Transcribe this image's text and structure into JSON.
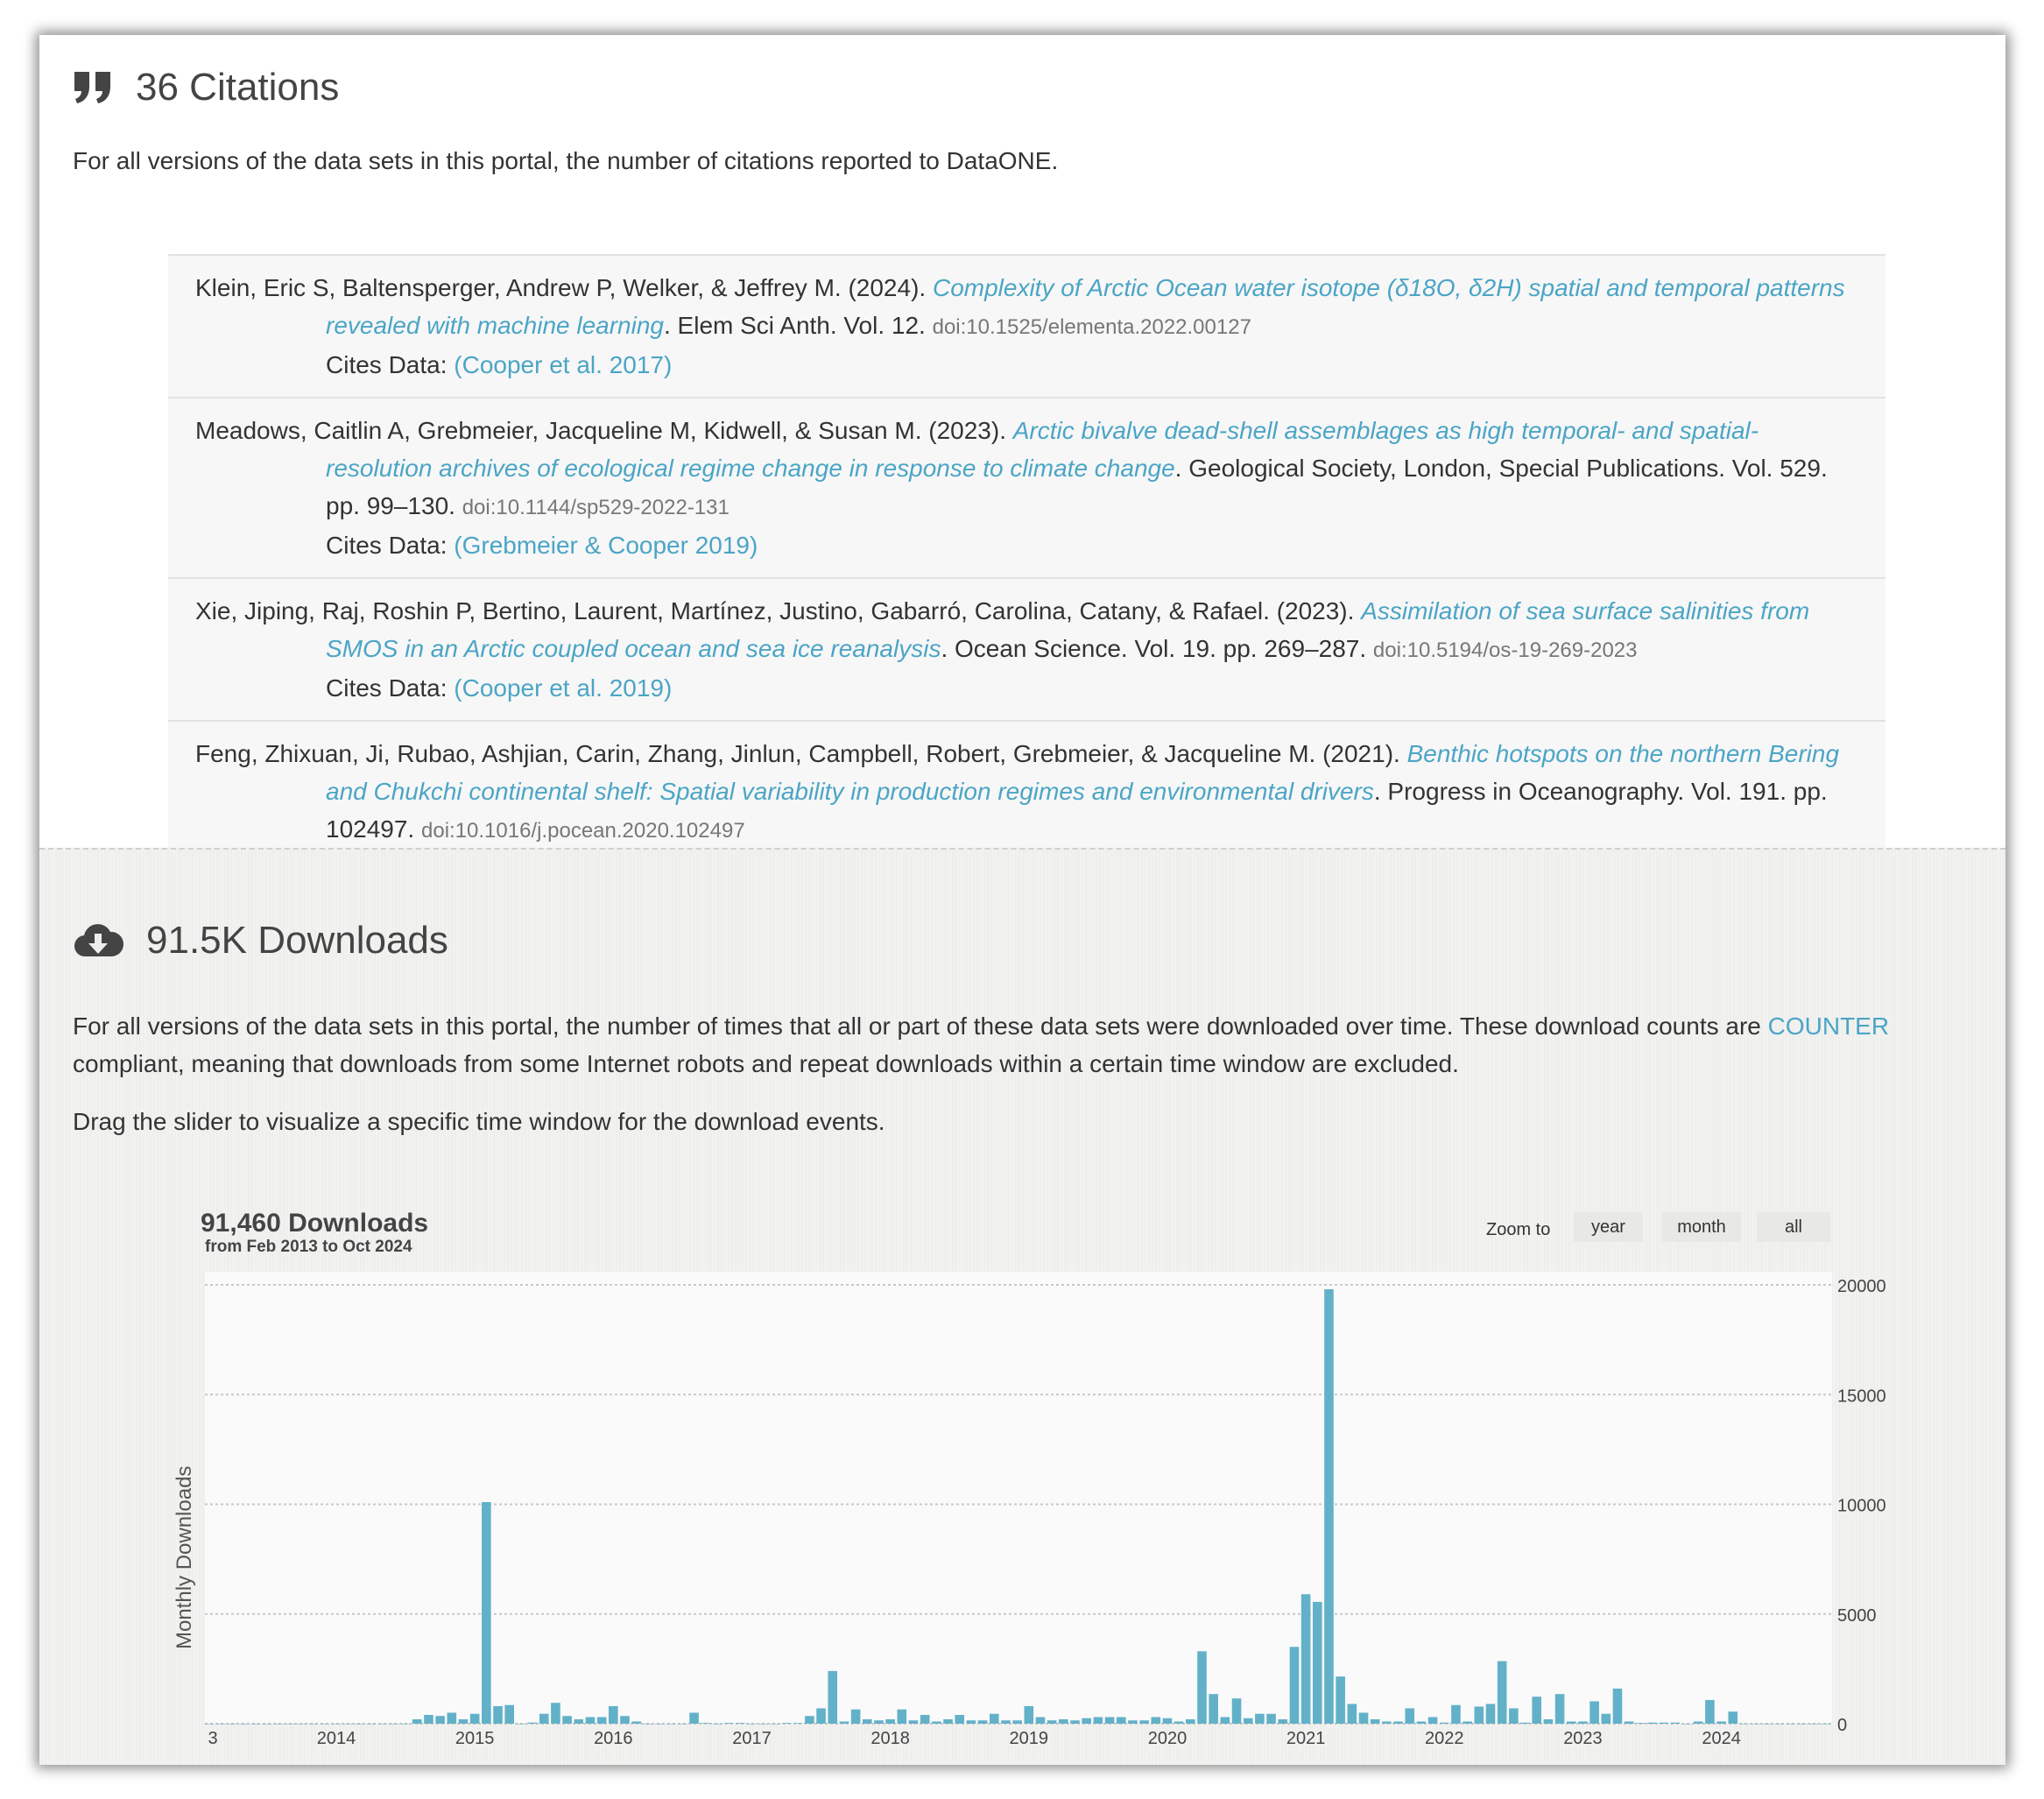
{
  "citations": {
    "heading": "36 Citations",
    "icon": "quote-icon",
    "description": "For all versions of the data sets in this portal, the number of citations reported to DataONE.",
    "items": [
      {
        "authors": "Klein, Eric S, Baltensperger, Andrew P, Welker, & Jeffrey M. (2024). ",
        "title": "Complexity of Arctic Ocean water isotope (δ18O, δ2H) spatial and temporal patterns revealed with machine learning",
        "rest": ". Elem Sci Anth. Vol. 12. ",
        "doi": "doi:10.1525/elementa.2022.00127",
        "cites_label": "Cites Data: ",
        "cites_link": "(Cooper et al. 2017)"
      },
      {
        "authors": "Meadows, Caitlin A, Grebmeier, Jacqueline M, Kidwell, & Susan M. (2023). ",
        "title": "Arctic bivalve dead-shell assemblages as high temporal- and spatial-resolution archives of ecological regime change in response to climate change",
        "rest": ". Geological Society, London, Special Publications. Vol. 529. pp. 99–130. ",
        "doi": "doi:10.1144/sp529-2022-131",
        "cites_label": "Cites Data: ",
        "cites_link": "(Grebmeier & Cooper 2019)"
      },
      {
        "authors": "Xie, Jiping, Raj, Roshin P, Bertino, Laurent, Martínez, Justino, Gabarró, Carolina, Catany, & Rafael. (2023). ",
        "title": "Assimilation of sea surface salinities from SMOS in an Arctic coupled ocean and sea ice reanalysis",
        "rest": ". Ocean Science. Vol. 19. pp. 269–287. ",
        "doi": "doi:10.5194/os-19-269-2023",
        "cites_label": "Cites Data: ",
        "cites_link": "(Cooper et al. 2019)"
      },
      {
        "authors": "Feng, Zhixuan, Ji, Rubao, Ashjian, Carin, Zhang, Jinlun, Campbell, Robert, Grebmeier, & Jacqueline M. (2021). ",
        "title": "Benthic hotspots on the northern Bering and Chukchi continental shelf: Spatial variability in production regimes and environmental drivers",
        "rest": ". Progress in Oceanography. Vol. 191. pp. 102497. ",
        "doi": "doi:10.1016/j.pocean.2020.102497"
      }
    ]
  },
  "downloads": {
    "heading": "91.5K Downloads",
    "icon": "cloud-download-icon",
    "description_before": "For all versions of the data sets in this portal, the number of times that all or part of these data sets were downloaded over time. These download counts are ",
    "counter_link": "COUNTER",
    "description_after": " compliant, meaning that downloads from some Internet robots and repeat downloads within a certain time window are excluded.",
    "slider_hint": "Drag the slider to visualize a specific time window for the download events.",
    "zoom_label": "Zoom to",
    "zoom_buttons": [
      "year",
      "month",
      "all"
    ]
  },
  "colors": {
    "bar": "#62b1c9",
    "link": "#4ba5c6"
  },
  "chart_data": {
    "type": "bar",
    "title": "91,460 Downloads",
    "subtitle": "from Feb 2013 to Oct 2024",
    "ylabel": "Monthly Downloads",
    "ylim": [
      0,
      20000
    ],
    "yticks": [
      "0",
      "5000",
      "10000",
      "15000",
      "20000"
    ],
    "xtick_labels": [
      "3",
      "2014",
      "2015",
      "2016",
      "2017",
      "2018",
      "2019",
      "2020",
      "2021",
      "2022",
      "2023",
      "2024"
    ],
    "grid": true,
    "start_month": "2013-02",
    "end_month": "2024-10",
    "values": [
      0,
      0,
      0,
      0,
      0,
      0,
      0,
      0,
      0,
      0,
      0,
      0,
      0,
      0,
      0,
      0,
      0,
      0,
      200,
      400,
      350,
      500,
      200,
      450,
      10100,
      800,
      850,
      0,
      50,
      450,
      950,
      350,
      200,
      300,
      300,
      800,
      350,
      100,
      0,
      0,
      0,
      0,
      500,
      30,
      0,
      30,
      30,
      0,
      0,
      0,
      30,
      30,
      350,
      700,
      2400,
      100,
      650,
      200,
      150,
      200,
      650,
      150,
      400,
      100,
      200,
      400,
      150,
      150,
      450,
      150,
      150,
      800,
      300,
      150,
      200,
      150,
      250,
      300,
      300,
      300,
      150,
      150,
      300,
      250,
      100,
      200,
      3300,
      1350,
      300,
      1150,
      250,
      450,
      450,
      200,
      3500,
      5900,
      5550,
      19800,
      2150,
      900,
      500,
      200,
      100,
      100,
      700,
      100,
      300,
      50,
      850,
      100,
      780,
      900,
      2850,
      700,
      50,
      1230,
      200,
      1350,
      100,
      100,
      1020,
      450,
      1600,
      100,
      30,
      50,
      50,
      50,
      0,
      100,
      1080,
      100,
      550,
      0,
      0,
      0,
      0,
      0,
      0,
      0,
      0
    ]
  }
}
